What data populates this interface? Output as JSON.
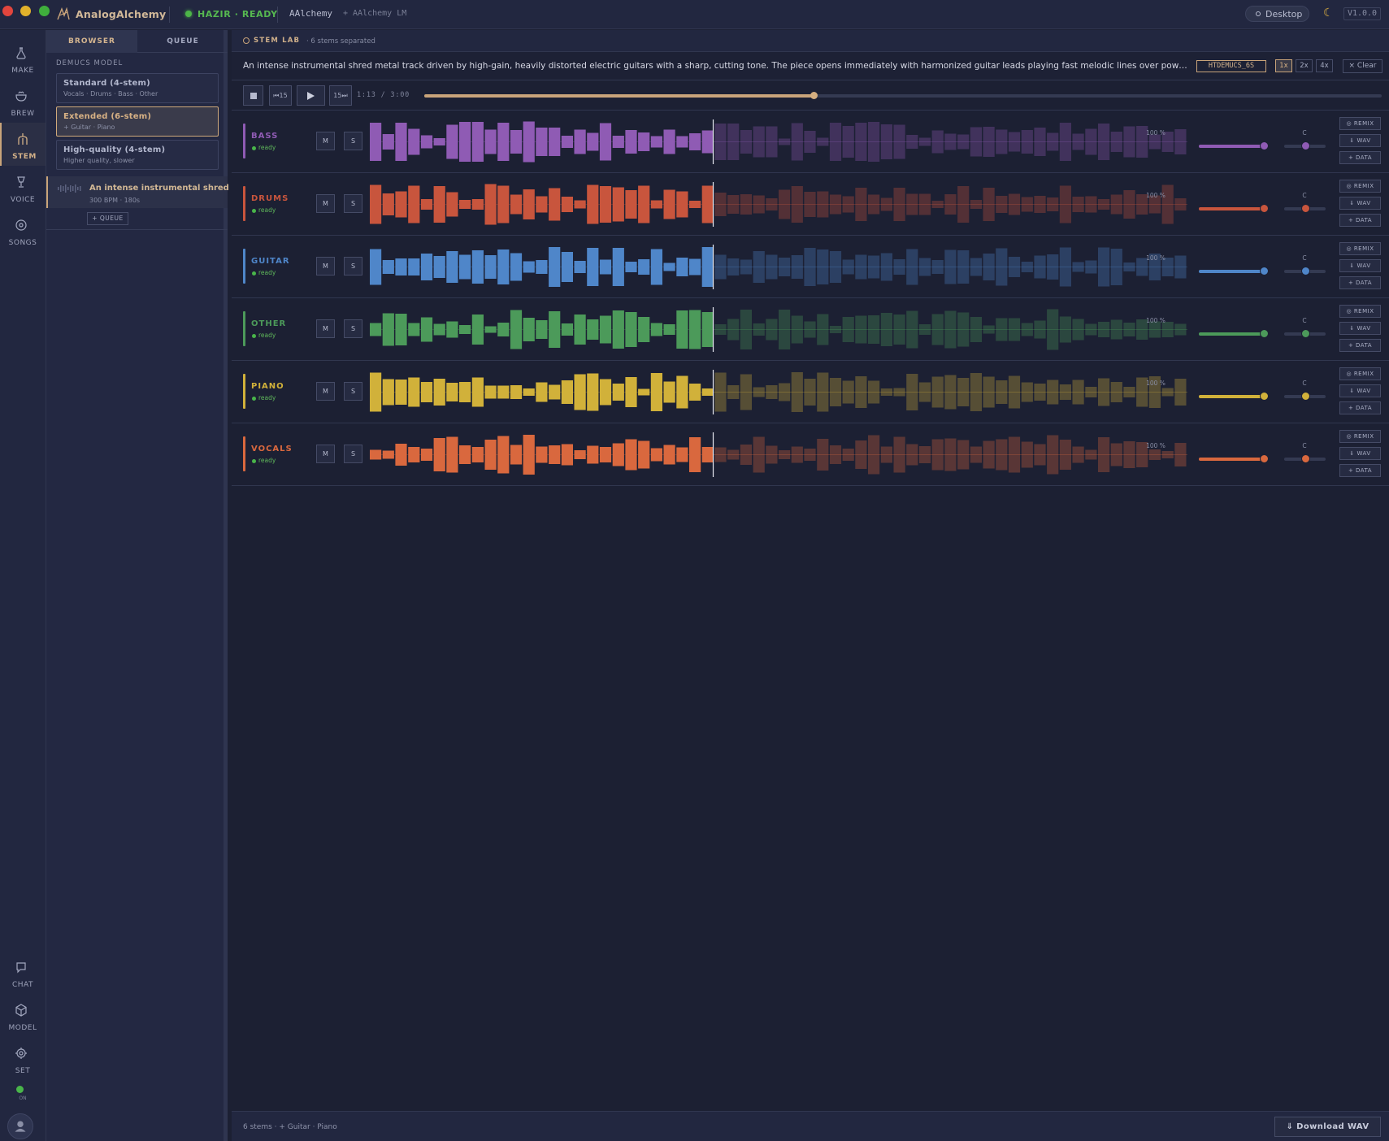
{
  "titlebar": {
    "app_name": "AnalogAlchemy",
    "status": "HAZIR · READY",
    "model": "AAlchemy",
    "model_sub": "+ AAlchemy LM",
    "mode": "Desktop",
    "version": "V1.0.0"
  },
  "rail": {
    "items": [
      {
        "label": "MAKE",
        "icon": "flask-icon"
      },
      {
        "label": "BREW",
        "icon": "cauldron-icon"
      },
      {
        "label": "STEM",
        "icon": "split-icon"
      },
      {
        "label": "VOICE",
        "icon": "mic-icon"
      },
      {
        "label": "SONGS",
        "icon": "disc-icon"
      }
    ],
    "bottom": [
      {
        "label": "CHAT",
        "icon": "chat-icon"
      },
      {
        "label": "MODEL",
        "icon": "cube-icon"
      },
      {
        "label": "SET",
        "icon": "gear-icon"
      }
    ],
    "power": "ON",
    "active": "STEM"
  },
  "panel": {
    "tabs": [
      "BROWSER",
      "QUEUE"
    ],
    "section": "DEMUCS MODEL",
    "models": [
      {
        "title": "Standard (4-stem)",
        "sub": "Vocals · Drums · Bass · Other"
      },
      {
        "title": "Extended (6-stem)",
        "sub": "+ Guitar · Piano"
      },
      {
        "title": "High-quality (4-stem)",
        "sub": "Higher quality, slower"
      }
    ],
    "selected_model": 1,
    "song": {
      "title": "An intense instrumental shred m...",
      "meta": "300 BPM · 180s"
    },
    "queue_button": "+ QUEUE"
  },
  "lab": {
    "title": "STEM LAB",
    "subtitle": "· 6 stems separated",
    "prompt": "An intense instrumental shred metal track driven by high-gain, heavily distorted electric guitars with a sharp, cutting tone. The piece opens immediately with harmonized guitar leads playing fast melodic lines over powerful double...",
    "tag": "HTDEMUCS_6S",
    "zoom": [
      "1x",
      "2x",
      "4x"
    ],
    "zoom_active": 0,
    "clear": "× Clear"
  },
  "transport": {
    "back_label": "⏮15",
    "fwd_label": "15⏭",
    "time": "1:13 / 3:00",
    "progress": 0.407
  },
  "tracks": [
    {
      "name": "BASS",
      "status": "ready",
      "color": "#8f5bb4",
      "volume_label": "100 %",
      "volume": 1.0,
      "pan_label": "C",
      "pan": 0.5
    },
    {
      "name": "DRUMS",
      "status": "ready",
      "color": "#c8553d",
      "volume_label": "100 %",
      "volume": 1.0,
      "pan_label": "C",
      "pan": 0.5
    },
    {
      "name": "GUITAR",
      "status": "ready",
      "color": "#4f86c9",
      "volume_label": "100 %",
      "volume": 1.0,
      "pan_label": "C",
      "pan": 0.5
    },
    {
      "name": "OTHER",
      "status": "ready",
      "color": "#4c9a5a",
      "volume_label": "100 %",
      "volume": 1.0,
      "pan_label": "C",
      "pan": 0.5
    },
    {
      "name": "PIANO",
      "status": "ready",
      "color": "#d1b13a",
      "volume_label": "100 %",
      "volume": 1.0,
      "pan_label": "C",
      "pan": 0.5
    },
    {
      "name": "VOCALS",
      "status": "ready",
      "color": "#d9683e",
      "volume_label": "100 %",
      "volume": 1.0,
      "pan_label": "C",
      "pan": 0.5
    }
  ],
  "track_buttons": {
    "mute": "M",
    "solo": "S",
    "remix": "◎ REMIX",
    "wav": "⇓ WAV",
    "data": "+ DATA"
  },
  "footer": {
    "summary": "6 stems · + Guitar · Piano",
    "download": "⇓ Download WAV"
  }
}
